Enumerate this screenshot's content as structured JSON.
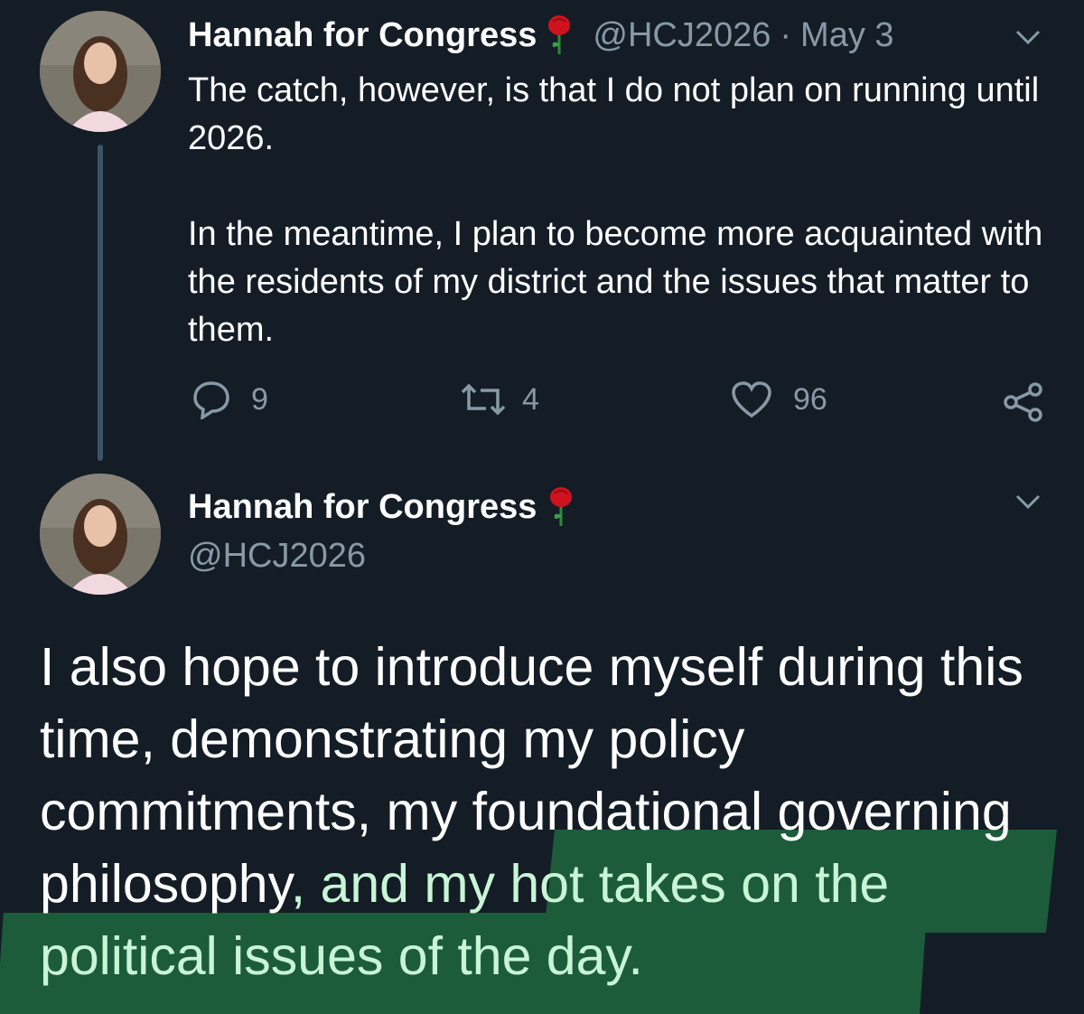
{
  "tweet1": {
    "display_name": "Hannah for Congress",
    "handle": "@HCJ2026",
    "separator": "·",
    "date": "May 3",
    "text": "The catch, however, is that I do not plan on running until 2026.\n\nIn the meantime, I plan to become more acquainted with the residents of my district and the issues that matter to them.",
    "replies": "9",
    "retweets": "4",
    "likes": "96"
  },
  "tweet2": {
    "display_name": "Hannah for Congress",
    "handle": "@HCJ2026",
    "text_plain": "I also hope to introduce myself during this time, demonstrating my policy commitments, my foundational governing philosophy",
    "text_highlighted": ", and my hot takes on the political issues of the day."
  },
  "icons": {
    "rose": "rose-emoji-icon",
    "chevron": "chevron-down-icon",
    "reply": "reply-bubble-icon",
    "retweet": "retweet-icon",
    "like": "heart-icon",
    "share": "share-icon"
  },
  "colors": {
    "background": "#141d26",
    "muted_text": "#8899a6",
    "highlight_marker": "#1c5c3a",
    "highlight_text": "#c8f5d6"
  }
}
